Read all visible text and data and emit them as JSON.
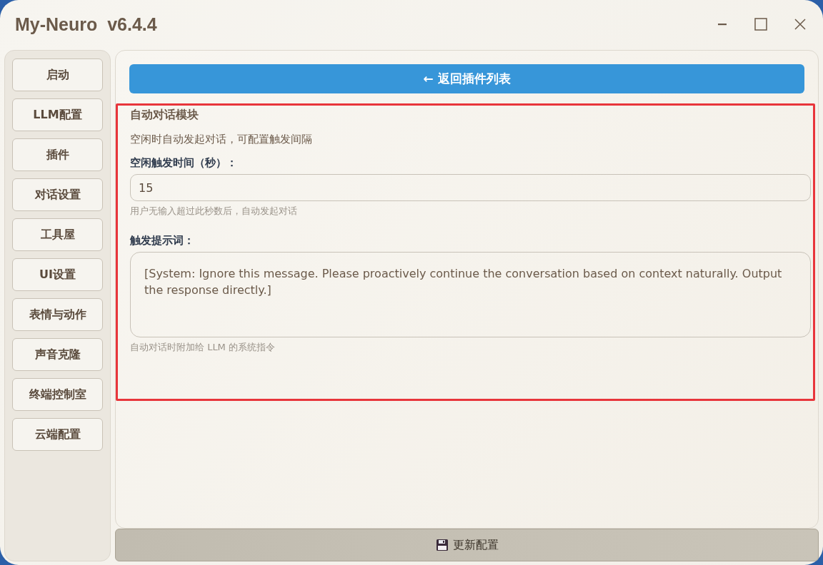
{
  "window": {
    "title": "My-Neuro  v6.4.4"
  },
  "sidebar": {
    "items": [
      {
        "label": "启动"
      },
      {
        "label": "LLM配置"
      },
      {
        "label": "插件"
      },
      {
        "label": "对话设置"
      },
      {
        "label": "工具屋"
      },
      {
        "label": "UI设置"
      },
      {
        "label": "表情与动作"
      },
      {
        "label": "声音克隆"
      },
      {
        "label": "终端控制室"
      },
      {
        "label": "云端配置"
      }
    ]
  },
  "back_button": {
    "label": "← 返回插件列表"
  },
  "plugin": {
    "title": "自动对话模块",
    "description": "空闲时自动发起对话，可配置触发间隔",
    "fields": [
      {
        "kind": "input",
        "label": "空闲触发时间（秒）：",
        "value": "15",
        "hint": "用户无输入超过此秒数后，自动发起对话"
      },
      {
        "kind": "textarea",
        "label": "触发提示词：",
        "value": "[System: Ignore this message. Please proactively continue the conversation based on context naturally. Output the response directly.]",
        "hint": "自动对话时附加给 LLM 的系统指令"
      }
    ]
  },
  "save_button": {
    "label": "更新配置"
  }
}
